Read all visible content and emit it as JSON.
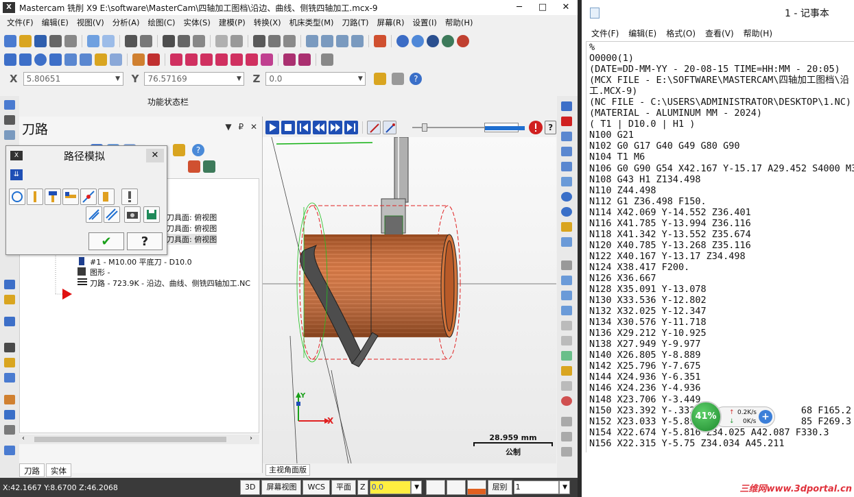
{
  "mastercam": {
    "title": "Mastercam 铣削 X9  E:\\software\\MasterCam\\四轴加工图档\\沿边、曲线、侧铣四轴加工.mcx-9",
    "menu": [
      "文件(F)",
      "编辑(E)",
      "视图(V)",
      "分析(A)",
      "绘图(C)",
      "实体(S)",
      "建模(P)",
      "转换(X)",
      "机床类型(M)",
      "刀路(T)",
      "屏幕(R)",
      "设置(I)",
      "帮助(H)"
    ],
    "coords": {
      "x_label": "X",
      "x_value": "5.80651",
      "y_label": "Y",
      "y_value": "76.57169",
      "z_label": "Z",
      "z_value": "0.0"
    },
    "status_bar_label": "功能状态栏",
    "toolpath_panel": {
      "title": "刀路",
      "tree": [
        "刀具面: 俯视图",
        "刀具面: 俯视图",
        "刀具面: 俯视图",
        "#1 - M10.00 平底刀 - D10.0",
        "图形 -",
        "刀路 - 723.9K - 沿边、曲线、侧铣四轴加工.NC"
      ],
      "tabs": [
        "刀路",
        "实体"
      ]
    },
    "sim_dialog": {
      "title": "路径模拟",
      "ok": "✔",
      "help": "?"
    },
    "viewport": {
      "tab": "主视角面版",
      "scale_value": "28.959 mm",
      "scale_unit": "公制",
      "axis_x": "X",
      "axis_y": "Y"
    },
    "statusbar": {
      "xyz": "X:42.1667  Y:8.6700  Z:46.2068",
      "btn_3d": "3D",
      "btn_screen_view": "屏幕视图",
      "btn_wcs": "WCS",
      "btn_plane": "平面",
      "z_label": "Z",
      "z_value": "0.0",
      "layer_label": "层别",
      "layer_value": "1"
    }
  },
  "notepad": {
    "title": "1 - 记事本",
    "menu": [
      "文件(F)",
      "编辑(E)",
      "格式(O)",
      "查看(V)",
      "帮助(H)"
    ],
    "lines": [
      "%",
      "O0000(1)",
      "(DATE=DD-MM-YY - 20-08-15 TIME=HH:MM - 20:05)",
      "(MCX FILE - E:\\SOFTWARE\\MASTERCAM\\四轴加工图档\\沿",
      "工.MCX-9)",
      "(NC FILE - C:\\USERS\\ADMINISTRATOR\\DESKTOP\\1.NC)",
      "(MATERIAL - ALUMINUM MM - 2024)",
      "( T1 | D10.0 | H1 )",
      "N100 G21",
      "N102 G0 G17 G40 G49 G80 G90",
      "N104 T1 M6",
      "N106 G0 G90 G54 X42.167 Y-15.17 A29.452 S4000 M3",
      "N108 G43 H1 Z134.498",
      "N110 Z44.498",
      "N112 G1 Z36.498 F150.",
      "N114 X42.069 Y-14.552 Z36.401",
      "N116 X41.785 Y-13.994 Z36.116",
      "N118 X41.342 Y-13.552 Z35.674",
      "N120 X40.785 Y-13.268 Z35.116",
      "N122 X40.167 Y-13.17 Z34.498",
      "N124 X38.417 F200.",
      "N126 X36.667",
      "N128 X35.091 Y-13.078",
      "N130 X33.536 Y-12.802",
      "N132 X32.025 Y-12.347",
      "N134 X30.576 Y-11.718",
      "N136 X29.212 Y-10.925",
      "N138 X27.949 Y-9.977",
      "N140 X26.805 Y-8.889",
      "N142 X25.796 Y-7.675",
      "N144 X24.936 Y-6.351",
      "N146 X24.236 Y-4.936",
      "N148 X23.706 Y-3.449",
      "N150 X23.392 Y-.332                   68 F165.2",
      "N152 X23.033 Y-5.89                   85 F269.3",
      "N154 X22.674 Y-5.816 Z34.025 A42.087 F330.3",
      "N156 X22.315 Y-5.75 Z34.034 A45.211"
    ]
  },
  "speed_widget": {
    "percent": "41%",
    "up": "0.2K/s",
    "down": "0K/s",
    "plus": "+"
  },
  "watermark": "三维网www.3dportal.cn",
  "colors": {
    "toolbar_blue": "#1f4fb5",
    "part_copper": "#c8622a",
    "boundary_red": "#e02020",
    "speed_green": "#2ea23e"
  }
}
